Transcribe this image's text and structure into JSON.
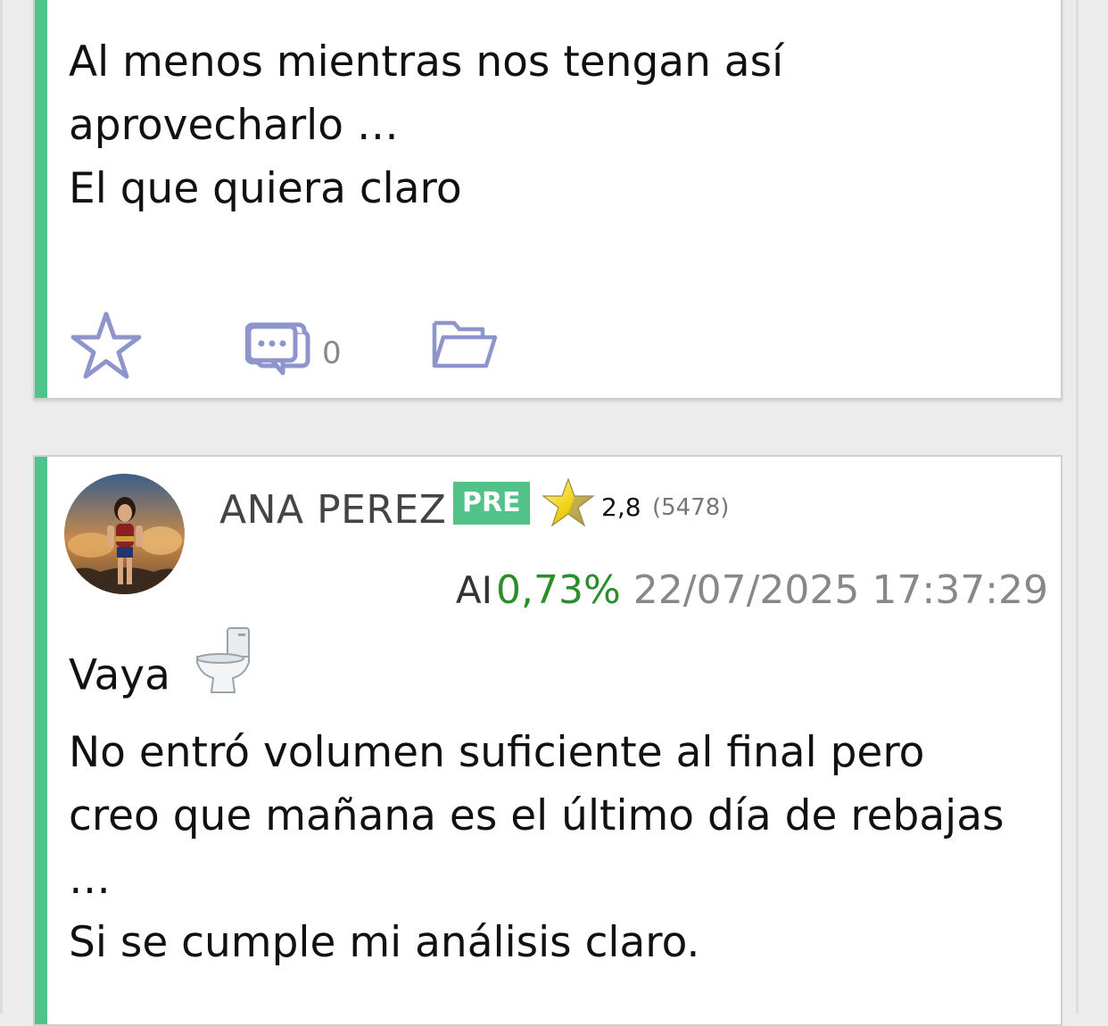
{
  "post1": {
    "lines": [
      "Al menos mientras nos tengan así",
      "aprovecharlo …",
      "El que quiera claro"
    ],
    "actions": {
      "favorite_icon": "star-outline-icon",
      "comment_icon": "comment-bubble-icon",
      "comment_count": "0",
      "save_icon": "folder-icon"
    }
  },
  "post2": {
    "author": "ANA PEREZ",
    "badge": "PRE",
    "rating": "2,8",
    "rating_count": "(5478)",
    "ai_label": "AI",
    "ai_percent": "0,73%",
    "timestamp": "22/07/2025 17:37:29",
    "lines": [
      "Vaya",
      "No entró volumen suficiente al final pero",
      "creo que mañana es el último día de rebajas",
      "…",
      "Si se cumple mi análisis claro."
    ],
    "inline_icon": "toilet-icon"
  },
  "colors": {
    "accent": "#4ec38a",
    "badge": "#52c288",
    "percent": "#2a8f2a",
    "icon": "#8e95cc"
  }
}
